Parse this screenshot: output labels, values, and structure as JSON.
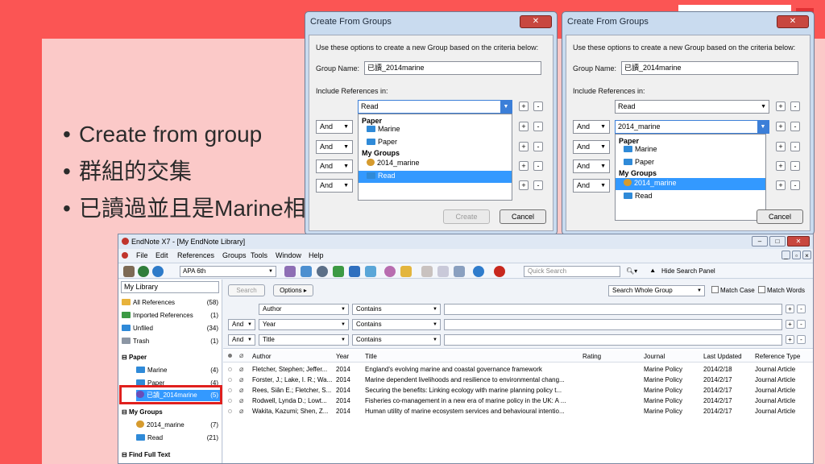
{
  "slide": {
    "bullets": [
      "Create from group",
      "群組的交集",
      "已讀過並且是Marine相關資料"
    ]
  },
  "dialog1": {
    "title": "Create From Groups",
    "instruction": "Use these options to create a new Group based on the criteria below:",
    "group_name_label": "Group Name:",
    "group_name_value": "已讀_2014marine",
    "include_label": "Include References in:",
    "first_combo": "Read",
    "and_label": "And",
    "dropdown": {
      "paper_header": "Paper",
      "marine": "Marine",
      "paper": "Paper",
      "mygroups_header": "My Groups",
      "smart": "2014_marine",
      "read": "Read"
    },
    "create_button": "Create",
    "cancel_button": "Cancel"
  },
  "dialog2": {
    "title": "Create From Groups",
    "instruction": "Use these options to create a new Group based on the criteria below:",
    "group_name_label": "Group Name:",
    "group_name_value": "已讀_2014marine",
    "include_label": "Include References in:",
    "first_combo": "Read",
    "second_combo": "2014_marine",
    "and_label": "And",
    "dropdown": {
      "paper_header": "Paper",
      "marine": "Marine",
      "paper": "Paper",
      "mygroups_header": "My Groups",
      "smart": "2014_marine",
      "read": "Read"
    },
    "cancel_button": "Cancel"
  },
  "endnote": {
    "title": "EndNote X7 - [My EndNote Library]",
    "menu": [
      "File",
      "Edit",
      "References",
      "Groups",
      "Tools",
      "Window",
      "Help"
    ],
    "style": "APA 6th",
    "quick_search": "Quick Search",
    "hide_panel": "Hide Search Panel",
    "library_header": "My Library",
    "groups": {
      "all": {
        "label": "All References",
        "count": "(58)"
      },
      "imported": {
        "label": "Imported References",
        "count": "(1)"
      },
      "unfiled": {
        "label": "Unfiled",
        "count": "(34)"
      },
      "trash": {
        "label": "Trash",
        "count": "(1)"
      },
      "paper_section": "Paper",
      "marine": {
        "label": "Marine",
        "count": "(4)"
      },
      "paper": {
        "label": "Paper",
        "count": "(4)"
      },
      "combined": {
        "label": "已讀_2014marine",
        "count": "(5)"
      },
      "mygroups_section": "My Groups",
      "smart": {
        "label": "2014_marine",
        "count": "(7)"
      },
      "read": {
        "label": "Read",
        "count": "(21)"
      },
      "fulltext_section": "Find Full Text"
    },
    "search": {
      "search_btn": "Search",
      "options_btn": "Options",
      "scope": "Search Whole Group",
      "match_case": "Match Case",
      "match_words": "Match Words",
      "rows": [
        {
          "bool": "",
          "field": "Author",
          "op": "Contains"
        },
        {
          "bool": "And",
          "field": "Year",
          "op": "Contains"
        },
        {
          "bool": "And",
          "field": "Title",
          "op": "Contains"
        }
      ]
    },
    "table": {
      "headers": [
        "Author",
        "Year",
        "Title",
        "Rating",
        "Journal",
        "Last Updated",
        "Reference Type"
      ],
      "rows": [
        [
          "Fletcher, Stephen; Jeffer...",
          "2014",
          "England's evolving marine and coastal governance framework",
          "",
          "Marine Policy",
          "2014/2/18",
          "Journal Article"
        ],
        [
          "Forster, J.; Lake, I. R.; Wa...",
          "2014",
          "Marine dependent livelihoods and resilience to environmental chang...",
          "",
          "Marine Policy",
          "2014/2/17",
          "Journal Article"
        ],
        [
          "Rees, Siân E.; Fletcher, S...",
          "2014",
          "Securing the benefits: Linking ecology with marine planning policy t...",
          "",
          "Marine Policy",
          "2014/2/17",
          "Journal Article"
        ],
        [
          "Rodwell, Lynda D.; Lowt...",
          "2014",
          "Fisheries co-management in a new era of marine policy in the UK: A ...",
          "",
          "Marine Policy",
          "2014/2/17",
          "Journal Article"
        ],
        [
          "Wakita, Kazumi; Shen, Z...",
          "2014",
          "Human utility of marine ecosystem services and behavioural intentio...",
          "",
          "Marine Policy",
          "2014/2/17",
          "Journal Article"
        ]
      ]
    }
  }
}
